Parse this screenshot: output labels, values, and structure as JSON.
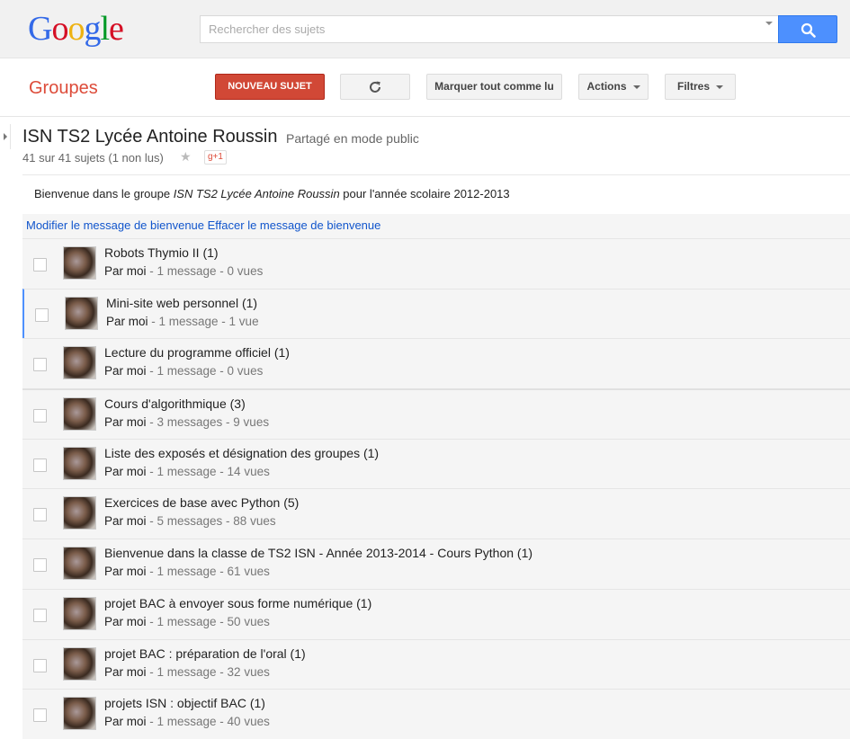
{
  "header": {
    "logo": [
      "G",
      "o",
      "o",
      "g",
      "l",
      "e"
    ],
    "logo_colors": [
      "#3369e8",
      "#d50f25",
      "#eeb211",
      "#3369e8",
      "#009925",
      "#d50f25"
    ],
    "search_placeholder": "Rechercher des sujets",
    "search_icon": "search-icon"
  },
  "appbar": {
    "title": "Groupes",
    "new_topic": "NOUVEAU SUJET",
    "refresh_icon": "refresh-icon",
    "mark_read": "Marquer tout comme lu",
    "actions": "Actions",
    "filters": "Filtres"
  },
  "group": {
    "name": "ISN TS2 Lycée Antoine Roussin",
    "shared": "Partagé en mode public",
    "count": "41 sur 41 sujets (1 non lus)",
    "star": "★",
    "gplus": "g+1",
    "welcome_prefix": "Bienvenue dans le groupe ",
    "welcome_name": "ISN TS2 Lycée Antoine Roussin",
    "welcome_suffix": " pour l'année scolaire 2012-2013",
    "edit_welcome": "Modifier le message de bienvenue",
    "delete_welcome": "Effacer le message de bienvenue"
  },
  "topics": [
    {
      "title": "Robots Thymio II  (1)",
      "author": "Par moi",
      "meta": " - 1 message - 0 vues"
    },
    {
      "title": "Mini-site web personnel  (1)",
      "author": "Par moi",
      "meta": " - 1 message - 1 vue"
    },
    {
      "title": "Lecture du programme officiel  (1)",
      "author": "Par moi",
      "meta": " - 1 message - 0 vues"
    },
    {
      "title": "Cours d'algorithmique  (3)",
      "author": "Par moi",
      "meta": " - 3 messages - 9 vues"
    },
    {
      "title": "Liste des exposés et désignation des groupes  (1)",
      "author": "Par moi",
      "meta": " - 1 message - 14 vues"
    },
    {
      "title": "Exercices de base avec Python  (5)",
      "author": "Par moi",
      "meta": " - 5 messages - 88 vues"
    },
    {
      "title": "Bienvenue dans la classe de TS2 ISN - Année 2013-2014 - Cours Python  (1)",
      "author": "Par moi",
      "meta": " - 1 message - 61 vues"
    },
    {
      "title": "projet BAC à envoyer sous forme numérique  (1)",
      "author": "Par moi",
      "meta": " - 1 message - 50 vues"
    },
    {
      "title": "projet BAC : préparation de l'oral  (1)",
      "author": "Par moi",
      "meta": " - 1 message - 32 vues"
    },
    {
      "title": "projets ISN : objectif BAC  (1)",
      "author": "Par moi",
      "meta": " - 1 message - 40 vues"
    }
  ]
}
